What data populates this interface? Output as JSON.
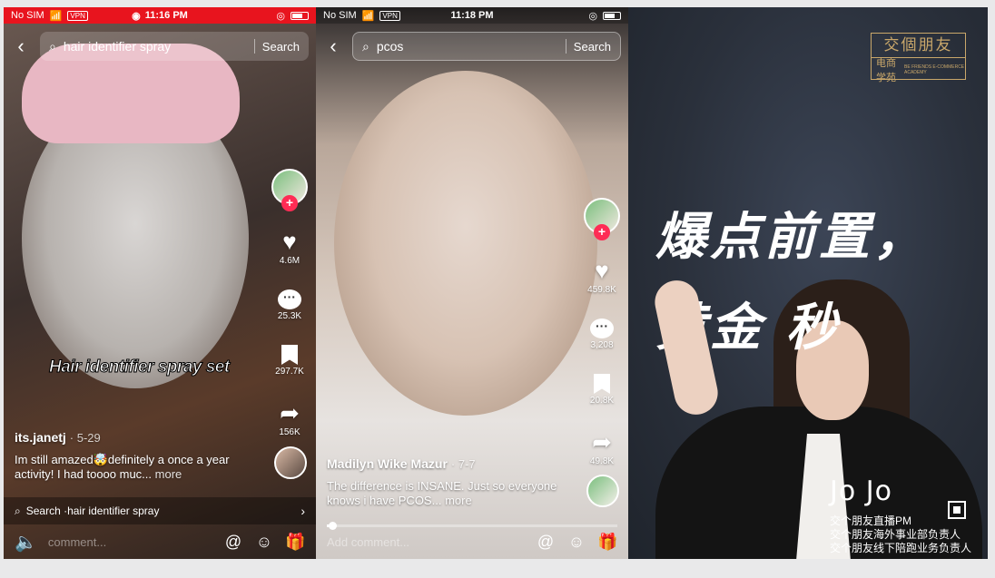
{
  "phone1": {
    "status": {
      "carrier": "No SIM",
      "vpn": "VPN",
      "time": "11:16 PM"
    },
    "search": {
      "query": "hair identifier spray",
      "button": "Search"
    },
    "overlay_caption": "Hair identifier spray set",
    "actions": {
      "likes": "4.6M",
      "comments": "25.3K",
      "saves": "297.7K",
      "shares": "156K"
    },
    "author": "its.janetj",
    "date": "· 5-29",
    "description": "Im still amazed🤯definitely a once a year activity! I had toooo muc...",
    "more": "more",
    "search_strip": "Search ·hair identifier spray",
    "comment_placeholder": "comment...",
    "progress": 0.0
  },
  "phone2": {
    "status": {
      "carrier": "No SIM",
      "vpn": "VPN",
      "time": "11:18 PM"
    },
    "search": {
      "query": "pcos",
      "button": "Search"
    },
    "actions": {
      "likes": "459.8K",
      "comments": "3,208",
      "saves": "20.8K",
      "shares": "49.8K"
    },
    "author": "Madilyn Wike Mazur",
    "date": "· 7-7",
    "description": "The difference is INSANE. Just so everyone knows i have PCOS...",
    "more": "more",
    "comment_placeholder": "Add comment...",
    "progress": 0.02
  },
  "video_panel": {
    "logo": {
      "main": "交個朋友",
      "sub_cn": "电商学苑",
      "sub_en": "BE FRIENDS E-COMMERCE ACADEMY"
    },
    "headline1": "爆点前置，",
    "headline2": "黄金 秒",
    "presenter_name": "Jo Jo",
    "presenter_titles": [
      "交个朋友直播PM",
      "交个朋友海外事业部负责人",
      "交个朋友线下陪跑业务负责人"
    ]
  },
  "icons": {
    "back": "chevron-left-icon",
    "search": "search-icon",
    "like": "heart-icon",
    "comment": "comment-bubble-icon",
    "save": "bookmark-icon",
    "share": "share-arrow-icon",
    "mention": "at-icon",
    "emoji": "emoji-icon",
    "gift": "gift-icon",
    "sound": "speaker-icon"
  },
  "colors": {
    "status_bar_recording": "#e8141e",
    "follow_plus": "#fe2c55",
    "logo_gold": "#c9a76a"
  }
}
